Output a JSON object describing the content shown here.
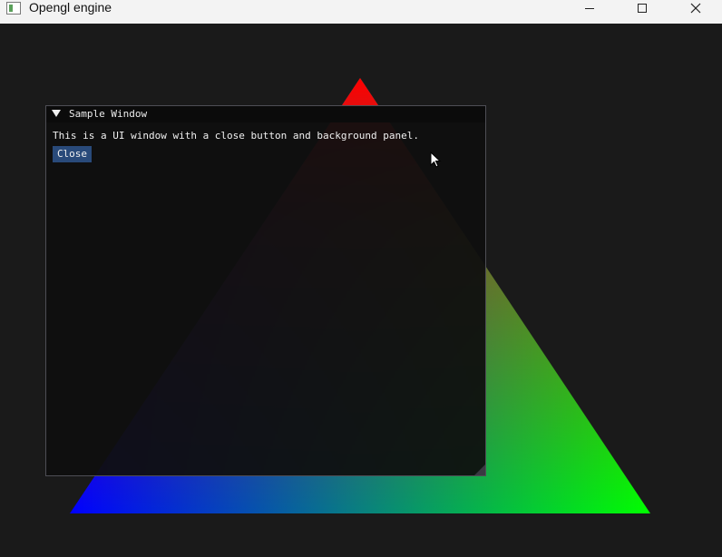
{
  "window": {
    "title": "Opengl engine",
    "icon": "app-icon",
    "controls": {
      "minimize_icon": "minimize-icon",
      "maximize_icon": "maximize-icon",
      "close_icon": "close-icon"
    }
  },
  "scene": {
    "background_color": "#1a1a1a",
    "triangle_colors": {
      "top": "#ff0000",
      "bottom_left": "#0000ff",
      "bottom_right": "#00ff00"
    }
  },
  "ui_window": {
    "title": "Sample Window",
    "collapse_icon": "collapse-triangle-icon",
    "text": "This is a UI window with a close button and background panel.",
    "close_button_label": "Close",
    "button_color": "#294a7a",
    "resize_icon": "resize-grip-icon"
  },
  "cursor": {
    "icon": "mouse-pointer-icon"
  }
}
